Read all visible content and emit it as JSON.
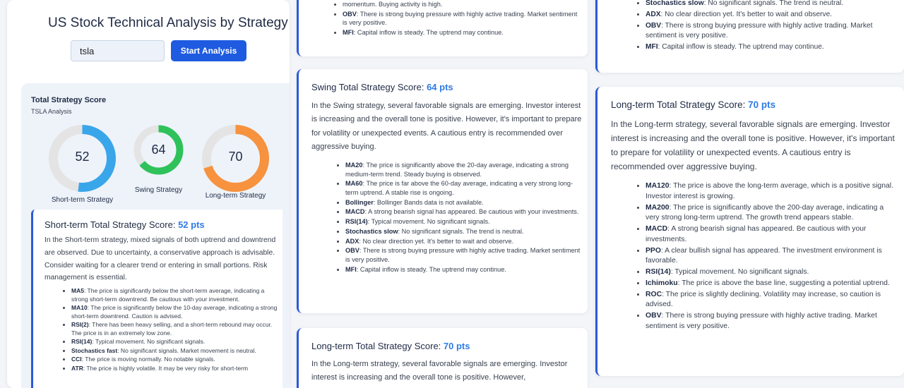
{
  "app": {
    "title": "US Stock Technical Analysis by Strategy"
  },
  "search": {
    "value": "tsla",
    "button_label": "Start Analysis"
  },
  "summary": {
    "title": "Total Strategy Score",
    "subtitle": "TSLA Analysis",
    "scores": [
      {
        "label": "Short-term Strategy",
        "value": 52,
        "color": "#3aa6ea"
      },
      {
        "label": "Swing Strategy",
        "value": 64,
        "color": "#2fc25b"
      },
      {
        "label": "Long-term Strategy",
        "value": 70,
        "color": "#f7923f"
      }
    ]
  },
  "short": {
    "title": "Short-term Total Strategy Score: ",
    "pts": "52 pts",
    "desc": "In the Short-term strategy, mixed signals of both uptrend and downtrend are observed. Due to uncertainty, a conservative approach is advisable. Consider waiting for a clearer trend or entering in small portions. Risk management is essential.",
    "items": [
      {
        "k": "MA5",
        "t": ": The price is significantly below the short-term average, indicating a strong short-term downtrend. Be cautious with your investment."
      },
      {
        "k": "MA10",
        "t": ": The price is significantly below the 10-day average, indicating a strong short-term downtrend. Caution is advised."
      },
      {
        "k": "RSI(2)",
        "t": ": There has been heavy selling, and a short-term rebound may occur. The price is in an extremely low zone."
      },
      {
        "k": "RSI(14)",
        "t": ": Typical movement. No significant signals."
      },
      {
        "k": "Stochastics fast",
        "t": ": No significant signals. Market movement is neutral."
      },
      {
        "k": "CCI",
        "t": ": The price is moving normally. No notable signals."
      },
      {
        "k": "ATR",
        "t": ": The price is highly volatile. It may be very risky for short-term"
      }
    ]
  },
  "top_mid": {
    "items": [
      {
        "k": "",
        "t": "momentum. Buying activity is high."
      },
      {
        "k": "OBV",
        "t": ": There is strong buying pressure with highly active trading. Market sentiment is very positive."
      },
      {
        "k": "MFI",
        "t": ": Capital inflow is steady. The uptrend may continue."
      }
    ]
  },
  "swing": {
    "title": "Swing Total Strategy Score: ",
    "pts": "64 pts",
    "desc": "In the Swing strategy, several favorable signals are emerging. Investor interest is increasing and the overall tone is positive. However, it's important to prepare for volatility or unexpected events. A cautious entry is recommended over aggressive buying.",
    "items": [
      {
        "k": "MA20",
        "t": ": The price is significantly above the 20-day average, indicating a strong medium-term trend. Steady buying is observed."
      },
      {
        "k": "MA60",
        "t": ": The price is far above the 60-day average, indicating a very strong long-term uptrend. A stable rise is ongoing."
      },
      {
        "k": "Bollinger",
        "t": ": Bollinger Bands data is not available."
      },
      {
        "k": "MACD",
        "t": ": A strong bearish signal has appeared. Be cautious with your investments."
      },
      {
        "k": "RSI(14)",
        "t": ": Typical movement. No significant signals."
      },
      {
        "k": "Stochastics slow",
        "t": ": No significant signals. The trend is neutral."
      },
      {
        "k": "ADX",
        "t": ": No clear direction yet. It's better to wait and observe."
      },
      {
        "k": "OBV",
        "t": ": There is strong buying pressure with highly active trading. Market sentiment is very positive."
      },
      {
        "k": "MFI",
        "t": ": Capital inflow is steady. The uptrend may continue."
      }
    ]
  },
  "long_mid": {
    "title": "Long-term Total Strategy Score: ",
    "pts": "70 pts",
    "desc": "In the Long-term strategy, several favorable signals are emerging. Investor interest is increasing and the overall tone is positive. However,"
  },
  "top_right": {
    "items": [
      {
        "k": "Stochastics slow",
        "t": ": No significant signals. The trend is neutral."
      },
      {
        "k": "ADX",
        "t": ": No clear direction yet. It's better to wait and observe."
      },
      {
        "k": "OBV",
        "t": ": There is strong buying pressure with highly active trading. Market sentiment is very positive."
      },
      {
        "k": "MFI",
        "t": ": Capital inflow is steady. The uptrend may continue."
      }
    ]
  },
  "long": {
    "title": "Long-term Total Strategy Score: ",
    "pts": "70 pts",
    "desc": "In the Long-term strategy, several favorable signals are emerging. Investor interest is increasing and the overall tone is positive. However, it's important to prepare for volatility or unexpected events. A cautious entry is recommended over aggressive buying.",
    "items": [
      {
        "k": "MA120",
        "t": ": The price is above the long-term average, which is a positive signal. Investor interest is growing."
      },
      {
        "k": "MA200",
        "t": ": The price is significantly above the 200-day average, indicating a very strong long-term uptrend. The growth trend appears stable."
      },
      {
        "k": "MACD",
        "t": ": A strong bearish signal has appeared. Be cautious with your investments."
      },
      {
        "k": "PPO",
        "t": ": A clear bullish signal has appeared. The investment environment is favorable."
      },
      {
        "k": "RSI(14)",
        "t": ": Typical movement. No significant signals."
      },
      {
        "k": "Ichimoku",
        "t": ": The price is above the base line, suggesting a potential uptrend."
      },
      {
        "k": "ROC",
        "t": ": The price is slightly declining. Volatility may increase, so caution is advised."
      },
      {
        "k": "OBV",
        "t": ": There is strong buying pressure with highly active trading. Market sentiment is very positive."
      }
    ]
  }
}
